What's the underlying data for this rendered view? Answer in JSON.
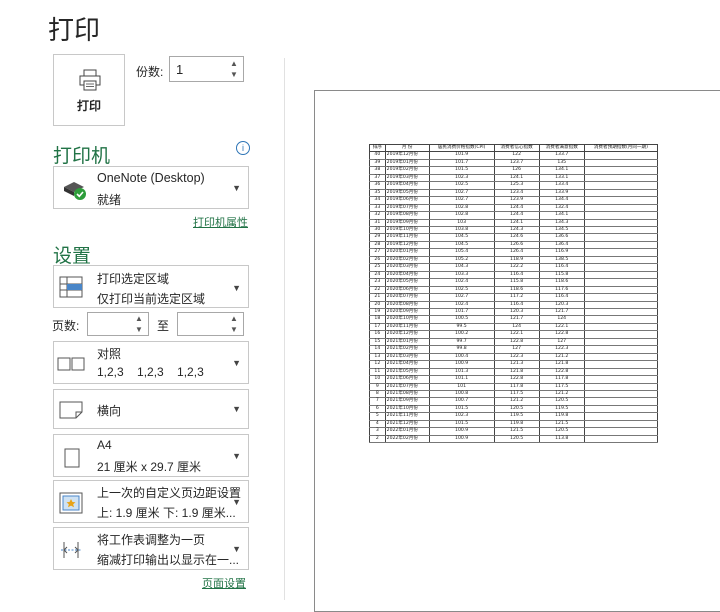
{
  "page_title": "打印",
  "print_button_label": "打印",
  "copies": {
    "label": "份数:",
    "value": "1"
  },
  "printer": {
    "section_title": "打印机",
    "info_glyph": "i",
    "name": "OneNote (Desktop)",
    "status": "就绪",
    "properties_link": "打印机属性"
  },
  "settings": {
    "section_title": "设置",
    "print_area": {
      "title": "打印选定区域",
      "subtitle": "仅打印当前选定区域"
    },
    "pages_label": "页数:",
    "to_label": "至",
    "collation": {
      "title": "对照",
      "subtitle": "1,2,3    1,2,3    1,2,3"
    },
    "orientation": {
      "title": "横向"
    },
    "paper": {
      "title": "A4",
      "subtitle": "21 厘米 x 29.7 厘米"
    },
    "margins": {
      "title": "上一次的自定义页边距设置",
      "subtitle": "上: 1.9 厘米 下: 1.9 厘米..."
    },
    "scaling": {
      "title": "将工作表调整为一页",
      "subtitle": "缩减打印输出以显示在一..."
    },
    "page_setup_link": "页面设置"
  },
  "preview_table": {
    "headers": [
      "排序",
      "月    份",
      "居民消费价格指数(CPI)",
      "消费者信心指数",
      "消费者满意指数",
      "消费者预期指数(月同一期)"
    ],
    "rows": [
      [
        "40",
        "2019年12月份",
        "101.9",
        "122",
        "133.7"
      ],
      [
        "39",
        "2019年01月份",
        "101.7",
        "123.7",
        "135"
      ],
      [
        "38",
        "2019年02月份",
        "101.5",
        "126",
        "134.1"
      ],
      [
        "37",
        "2019年03月份",
        "102.3",
        "124.1",
        "133.1"
      ],
      [
        "36",
        "2019年04月份",
        "102.5",
        "125.3",
        "133.4"
      ],
      [
        "35",
        "2019年05月份",
        "102.7",
        "123.4",
        "133.9"
      ],
      [
        "34",
        "2019年06月份",
        "102.7",
        "123.9",
        "134.4"
      ],
      [
        "33",
        "2019年07月份",
        "102.8",
        "124.4",
        "132.4"
      ],
      [
        "32",
        "2019年08月份",
        "102.8",
        "124.4",
        "134.1"
      ],
      [
        "31",
        "2019年09月份",
        "103",
        "124.1",
        "134.3"
      ],
      [
        "30",
        "2019年10月份",
        "103.8",
        "124.3",
        "134.5"
      ],
      [
        "29",
        "2019年11月份",
        "104.5",
        "124.6",
        "136.6"
      ],
      [
        "28",
        "2019年12月份",
        "104.5",
        "126.6",
        "136.4"
      ],
      [
        "27",
        "2020年01月份",
        "105.4",
        "126.4",
        "116.9"
      ],
      [
        "26",
        "2020年02月份",
        "105.2",
        "118.9",
        "138.5"
      ],
      [
        "25",
        "2020年03月份",
        "104.3",
        "122.2",
        "116.4"
      ],
      [
        "24",
        "2020年04月份",
        "103.3",
        "116.4",
        "115.8"
      ],
      [
        "23",
        "2020年05月份",
        "102.4",
        "115.8",
        "118.6"
      ],
      [
        "22",
        "2020年06月份",
        "102.5",
        "118.6",
        "117.6"
      ],
      [
        "21",
        "2020年07月份",
        "102.7",
        "117.2",
        "116.4"
      ],
      [
        "20",
        "2020年08月份",
        "102.4",
        "116.4",
        "120.3"
      ],
      [
        "19",
        "2020年09月份",
        "101.7",
        "120.3",
        "121.7"
      ],
      [
        "18",
        "2020年10月份",
        "100.5",
        "121.7",
        "124"
      ],
      [
        "17",
        "2020年11月份",
        "99.5",
        "124",
        "122.1"
      ],
      [
        "16",
        "2020年12月份",
        "100.2",
        "122.1",
        "122.8"
      ],
      [
        "15",
        "2021年01月份",
        "99.7",
        "122.8",
        "127"
      ],
      [
        "14",
        "2021年02月份",
        "99.8",
        "127",
        "122.3"
      ],
      [
        "13",
        "2021年03月份",
        "100.4",
        "122.3",
        "121.2"
      ],
      [
        "12",
        "2021年04月份",
        "100.9",
        "121.3",
        "121.8"
      ],
      [
        "11",
        "2021年05月份",
        "101.3",
        "121.8",
        "122.8"
      ],
      [
        "10",
        "2021年06月份",
        "101.1",
        "122.8",
        "117.8"
      ],
      [
        "9",
        "2021年07月份",
        "101",
        "117.8",
        "117.5"
      ],
      [
        "8",
        "2021年08月份",
        "100.8",
        "117.5",
        "121.2"
      ],
      [
        "7",
        "2021年09月份",
        "100.7",
        "121.2",
        "120.5"
      ],
      [
        "6",
        "2021年10月份",
        "101.5",
        "120.5",
        "119.5"
      ],
      [
        "5",
        "2021年11月份",
        "102.3",
        "119.5",
        "119.8"
      ],
      [
        "4",
        "2021年12月份",
        "101.5",
        "119.8",
        "121.5"
      ],
      [
        "3",
        "2022年01月份",
        "100.9",
        "121.5",
        "120.5"
      ],
      [
        "2",
        "2022年02月份",
        "100.9",
        "120.5",
        "113.8"
      ]
    ]
  },
  "colors": {
    "accent": "#217346",
    "link": "#217346",
    "info": "#2e75b6"
  },
  "icons": [
    "printer-icon",
    "printer-status-icon",
    "print-area-icon",
    "collate-icon",
    "landscape-icon",
    "paper-size-icon",
    "custom-margins-icon",
    "fit-to-page-icon"
  ]
}
